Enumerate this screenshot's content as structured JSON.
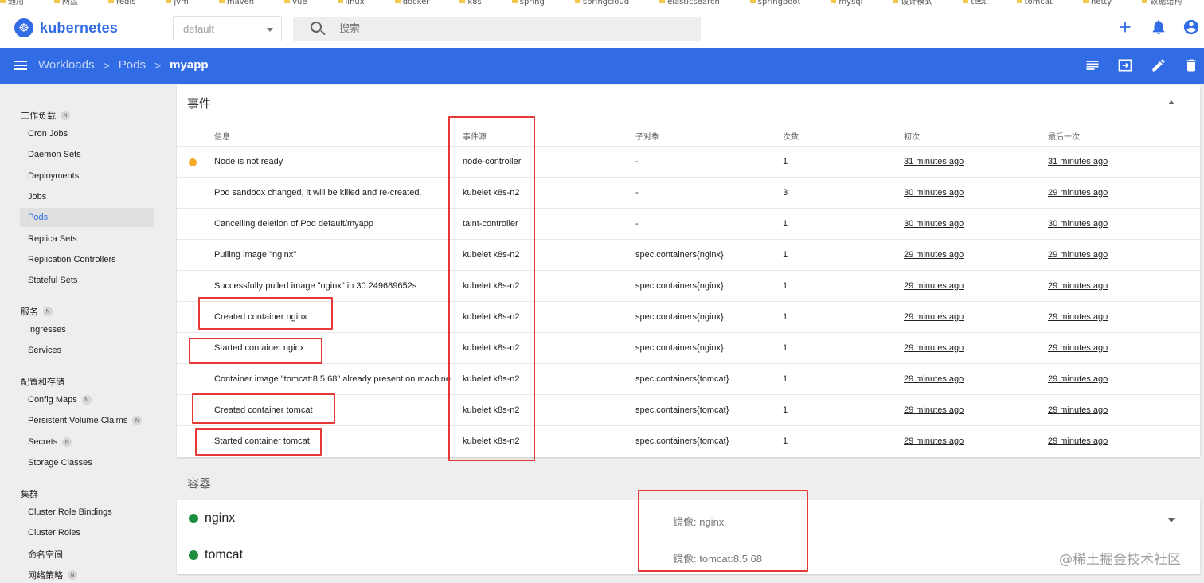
{
  "bookmarks": [
    "通用",
    "网盘",
    "redis",
    "jvm",
    "maven",
    "vue",
    "linux",
    "docker",
    "k8s",
    "spring",
    "springcloud",
    "elasticsearch",
    "springboot",
    "mysql",
    "设计模式",
    "test",
    "tomcat",
    "netty",
    "数据结构"
  ],
  "topbar": {
    "brand": "kubernetes",
    "namespace": "default",
    "search_placeholder": "搜索",
    "icons": [
      "plus-icon",
      "bell-icon",
      "account-icon"
    ]
  },
  "header": {
    "breadcrumbs": [
      "Workloads",
      "Pods",
      "myapp"
    ],
    "actions": [
      "logs-icon",
      "exec-icon",
      "edit-icon",
      "delete-icon"
    ]
  },
  "sidebar": {
    "badge_text": "N",
    "sections": [
      {
        "label": "工作负载",
        "badge": true,
        "items": [
          {
            "label": "Cron Jobs"
          },
          {
            "label": "Daemon Sets"
          },
          {
            "label": "Deployments"
          },
          {
            "label": "Jobs"
          },
          {
            "label": "Pods",
            "active": true
          },
          {
            "label": "Replica Sets"
          },
          {
            "label": "Replication Controllers"
          },
          {
            "label": "Stateful Sets"
          }
        ]
      },
      {
        "label": "服务",
        "badge": true,
        "items": [
          {
            "label": "Ingresses"
          },
          {
            "label": "Services"
          }
        ]
      },
      {
        "label": "配置和存储",
        "badge": false,
        "items": [
          {
            "label": "Config Maps",
            "badge": true
          },
          {
            "label": "Persistent Volume Claims",
            "badge": true
          },
          {
            "label": "Secrets",
            "badge": true
          },
          {
            "label": "Storage Classes"
          }
        ]
      },
      {
        "label": "集群",
        "badge": false,
        "items": [
          {
            "label": "Cluster Role Bindings"
          },
          {
            "label": "Cluster Roles"
          },
          {
            "label": "命名空间"
          },
          {
            "label": "网络策略",
            "badge": true
          }
        ]
      }
    ]
  },
  "events": {
    "title": "事件",
    "columns": [
      "信息",
      "事件源",
      "子对象",
      "次数",
      "初次",
      "最后一次"
    ],
    "rows": [
      {
        "warning": true,
        "message": "Node is not ready",
        "source": "node-controller",
        "sub_object": "-",
        "count": "1",
        "first": "31 minutes ago",
        "last": "31 minutes ago"
      },
      {
        "message": "Pod sandbox changed, it will be killed and re-created.",
        "source": "kubelet k8s-n2",
        "sub_object": "-",
        "count": "3",
        "first": "30 minutes ago",
        "last": "29 minutes ago"
      },
      {
        "message": "Cancelling deletion of Pod default/myapp",
        "source": "taint-controller",
        "sub_object": "-",
        "count": "1",
        "first": "30 minutes ago",
        "last": "30 minutes ago"
      },
      {
        "message": "Pulling image \"nginx\"",
        "source": "kubelet k8s-n2",
        "sub_object": "spec.containers{nginx}",
        "count": "1",
        "first": "29 minutes ago",
        "last": "29 minutes ago"
      },
      {
        "message": "Successfully pulled image \"nginx\" in 30.249689652s",
        "source": "kubelet k8s-n2",
        "sub_object": "spec.containers{nginx}",
        "count": "1",
        "first": "29 minutes ago",
        "last": "29 minutes ago"
      },
      {
        "message": "Created container nginx",
        "source": "kubelet k8s-n2",
        "sub_object": "spec.containers{nginx}",
        "count": "1",
        "first": "29 minutes ago",
        "last": "29 minutes ago"
      },
      {
        "message": "Started container nginx",
        "source": "kubelet k8s-n2",
        "sub_object": "spec.containers{nginx}",
        "count": "1",
        "first": "29 minutes ago",
        "last": "29 minutes ago"
      },
      {
        "message": "Container image \"tomcat:8.5.68\" already present on machine",
        "source": "kubelet k8s-n2",
        "sub_object": "spec.containers{tomcat}",
        "count": "1",
        "first": "29 minutes ago",
        "last": "29 minutes ago"
      },
      {
        "message": "Created container tomcat",
        "source": "kubelet k8s-n2",
        "sub_object": "spec.containers{tomcat}",
        "count": "1",
        "first": "29 minutes ago",
        "last": "29 minutes ago"
      },
      {
        "message": "Started container tomcat",
        "source": "kubelet k8s-n2",
        "sub_object": "spec.containers{tomcat}",
        "count": "1",
        "first": "29 minutes ago",
        "last": "29 minutes ago"
      }
    ]
  },
  "containers": {
    "title": "容器",
    "items": [
      {
        "name": "nginx",
        "image": "镜像: nginx"
      },
      {
        "name": "tomcat",
        "image": "镜像: tomcat:8.5.68"
      }
    ]
  },
  "watermark": "@稀土掘金技术社区",
  "colors": {
    "brand": "#326ce5",
    "warning": "#f9a825",
    "running": "#1e8e3e",
    "annotation": "#e53935"
  }
}
